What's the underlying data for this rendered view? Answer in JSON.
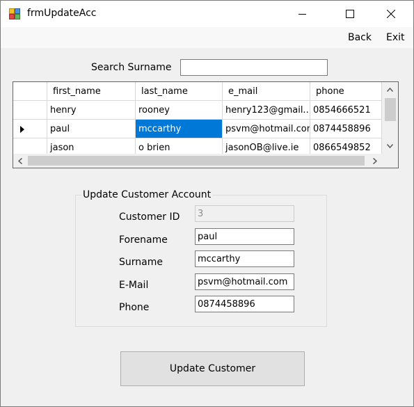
{
  "window": {
    "title": "frmUpdateAcc",
    "icon": "form-icon",
    "controls": [
      "minimize-icon",
      "maximize-icon",
      "close-icon"
    ]
  },
  "menu": {
    "back": "Back",
    "exit": "Exit"
  },
  "search": {
    "label": "Search Surname",
    "value": ""
  },
  "grid": {
    "columns": [
      "first_name",
      "last_name",
      "e_mail",
      "phone"
    ],
    "rows": [
      {
        "first_name": "henry",
        "last_name": "rooney",
        "e_mail": "henry123@gmail....",
        "phone": "0854666521",
        "current": false
      },
      {
        "first_name": "paul",
        "last_name": "mccarthy",
        "e_mail": "psvm@hotmail.com",
        "phone": "0874458896",
        "current": true
      },
      {
        "first_name": "jason",
        "last_name": "o brien",
        "e_mail": "jasonOB@live.ie",
        "phone": "0866549852",
        "current": false
      }
    ],
    "selected_cell": {
      "row": 1,
      "column": "last_name"
    },
    "colors": {
      "selection": "#0078d7"
    }
  },
  "account": {
    "title": "Update Customer Account",
    "customer_id_label": "Customer ID",
    "customer_id": "3",
    "forename_label": "Forename",
    "forename": "paul",
    "surname_label": "Surname",
    "surname": "mccarthy",
    "email_label": "E-Mail",
    "email": "psvm@hotmail.com",
    "phone_label": "Phone",
    "phone": "0874458896"
  },
  "update_button": "Update Customer"
}
